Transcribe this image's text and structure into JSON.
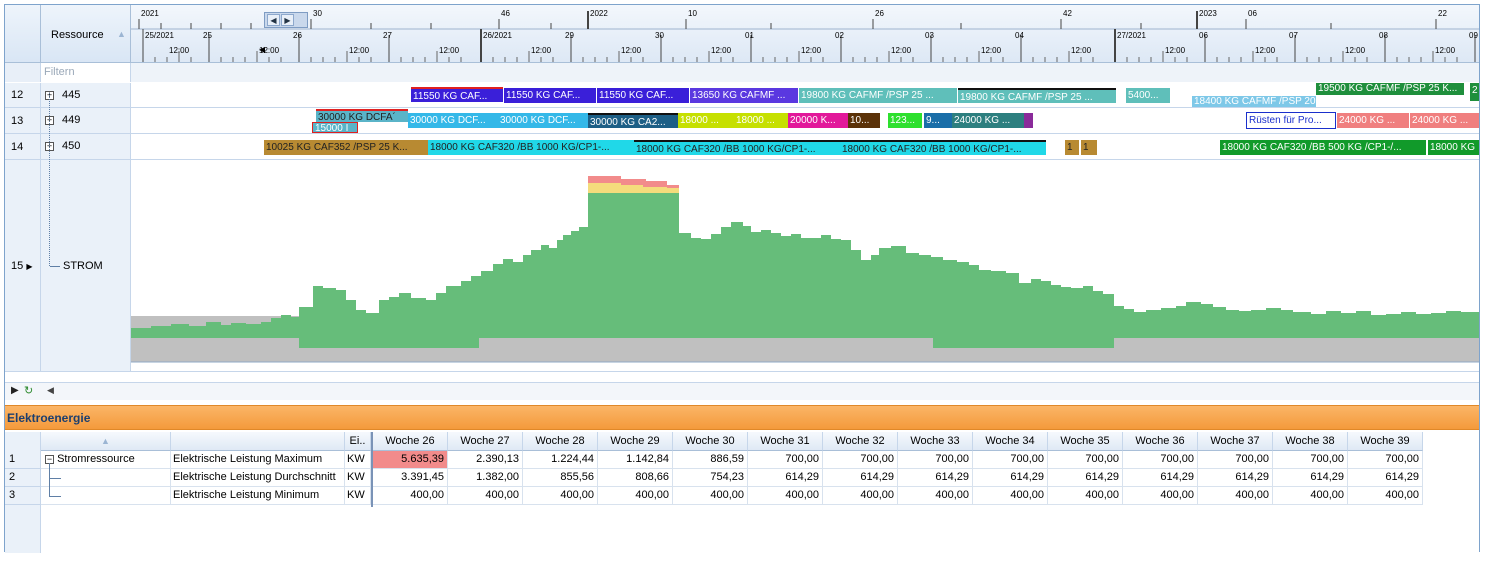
{
  "gantt": {
    "resource_header": "Ressource",
    "filter_placeholder": "Filtern",
    "timescale": {
      "top_labels": [
        "2021",
        "30",
        "46",
        "2022",
        "10",
        "26",
        "42",
        "2023",
        "06",
        "22"
      ],
      "bottom_labels": [
        "25/2021",
        "25",
        "26",
        "27",
        "26/2021",
        "29",
        "30",
        "01",
        "02",
        "03",
        "04",
        "27/2021",
        "06",
        "07",
        "08",
        "09"
      ],
      "hour_label": "12:00"
    },
    "rows": [
      {
        "num": "12",
        "name": "445"
      },
      {
        "num": "13",
        "name": "449"
      },
      {
        "num": "14",
        "name": "450"
      },
      {
        "num": "15",
        "name": "STROM"
      }
    ],
    "bars": {
      "row12": [
        "11550 KG CAF...",
        "11550 KG CAF...",
        "11550 KG CAF...",
        "13650 KG CAFMF ...",
        "19800 KG CAFMF    /PSP 25 ...",
        "19800 KG CAFMF    /PSP 25 ...",
        "5400...",
        "18400 KG CAFMF    /PSP 20",
        "19500 KG CAFMF    /PSP 25 K...",
        "2"
      ],
      "row13": [
        "30000 KG DCFA´",
        "15000 I",
        "30000 KG DCF...",
        "30000 KG DCF...",
        "30000 KG CA2...",
        "18000 ...",
        "18000 ...",
        "20000 K...",
        "10...",
        "123...",
        "9...",
        "24000 KG ...",
        "Rüsten für Pro...",
        "24000 KG ...",
        "24000 KG ..."
      ],
      "row14": [
        "10025 KG CAF352    /PSP 25 K...",
        "18000 KG CAF320    /BB 1000 KG/CP1-...",
        "18000 KG CAF320    /BB 1000 KG/CP1-...",
        "18000 KG CAF320    /BB 1000 KG/CP1-...",
        "1",
        "1",
        "18000 KG CAF320    /BB 500 KG /CP1-/...",
        "18000 KG"
      ]
    },
    "colors": {
      "strom_fill": "#66bd7a",
      "strom_base": "#c0c0c0",
      "peak_overload": "#f28b8b",
      "peak_warning": "#f4dc7c"
    }
  },
  "panel": {
    "title": "Elektroenergie",
    "columns": {
      "unit": "Ei..",
      "weeks": [
        "Woche 26",
        "Woche 27",
        "Woche 28",
        "Woche 29",
        "Woche 30",
        "Woche 31",
        "Woche 32",
        "Woche 33",
        "Woche 34",
        "Woche 35",
        "Woche 36",
        "Woche 37",
        "Woche 38",
        "Woche 39"
      ]
    },
    "rows": [
      {
        "num": "1",
        "resource": "Stromressource",
        "name": "Elektrische Leistung Maximum",
        "unit": "KW",
        "values": [
          "5.635,39",
          "2.390,13",
          "1.224,44",
          "1.142,84",
          "886,59",
          "700,00",
          "700,00",
          "700,00",
          "700,00",
          "700,00",
          "700,00",
          "700,00",
          "700,00",
          "700,00"
        ]
      },
      {
        "num": "2",
        "resource": "",
        "name": "Elektrische Leistung Durchschnitt",
        "unit": "KW",
        "values": [
          "3.391,45",
          "1.382,00",
          "855,56",
          "808,66",
          "754,23",
          "614,29",
          "614,29",
          "614,29",
          "614,29",
          "614,29",
          "614,29",
          "614,29",
          "614,29",
          "614,29"
        ]
      },
      {
        "num": "3",
        "resource": "",
        "name": "Elektrische Leistung Minimum",
        "unit": "KW",
        "values": [
          "400,00",
          "400,00",
          "400,00",
          "400,00",
          "400,00",
          "400,00",
          "400,00",
          "400,00",
          "400,00",
          "400,00",
          "400,00",
          "400,00",
          "400,00",
          "400,00"
        ]
      }
    ]
  }
}
